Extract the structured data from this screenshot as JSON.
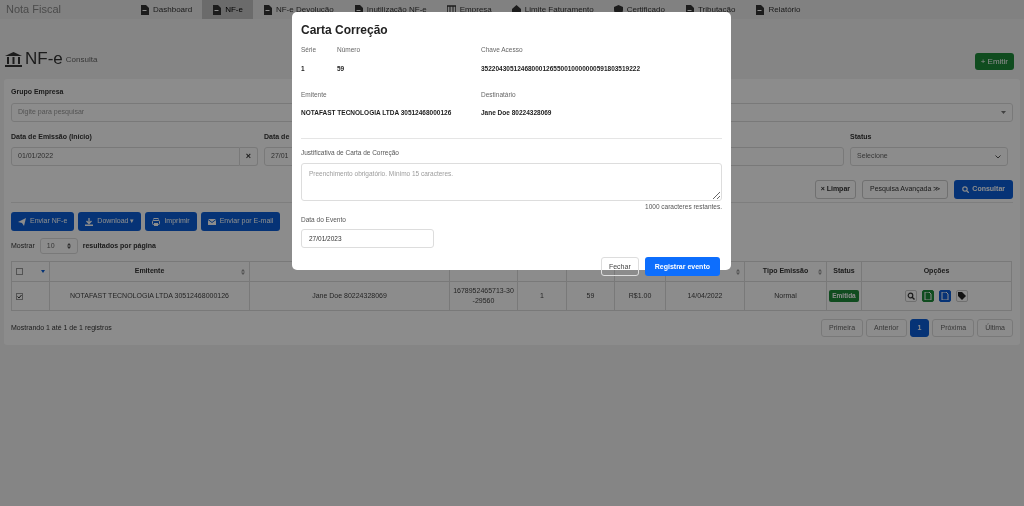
{
  "app_title": "Nota Fiscal",
  "nav": [
    {
      "label": "Dashboard",
      "selected": false
    },
    {
      "label": "NF-e",
      "selected": true
    },
    {
      "label": "NF-e Devolução",
      "selected": false
    },
    {
      "label": "Inutilização NF-e",
      "selected": false
    },
    {
      "label": "Empresa",
      "selected": false
    },
    {
      "label": "Limite Faturamento",
      "selected": false
    },
    {
      "label": "Certificado",
      "selected": false
    },
    {
      "label": "Tributação",
      "selected": false
    },
    {
      "label": "Relatório",
      "selected": false
    }
  ],
  "page": {
    "title": "NF-e",
    "subtitle": "Consulta",
    "emit_button": "+ Emitir"
  },
  "filters": {
    "grupo_label": "Grupo Empresa",
    "grupo_placeholder": "Digite para pesquisar",
    "inicio_label": "Data de Emissão (Início)",
    "inicio_value": "01/01/2022",
    "clear_glyph": "×",
    "fim_label": "Data de",
    "fim_value": "27/01",
    "status_label": "Status",
    "status_value": "Selecione",
    "buttons": [
      "× Limpar",
      "Pesquisa Avançada ≫",
      "Consultar"
    ]
  },
  "actions": [
    "Enviar NF-e",
    "Download ▾",
    "Imprimir",
    "Enviar por E-mail"
  ],
  "page_size": {
    "before": "Mostrar",
    "value": "10",
    "after": "resultados por página"
  },
  "table": {
    "columns": [
      {
        "label": "Emitente",
        "sortable": true
      },
      {},
      {},
      {},
      {},
      {},
      {
        "sortable": true
      },
      {
        "label": "Tipo Emissão",
        "sortable": true
      },
      {
        "label": "Status",
        "sortable": false
      },
      {
        "label": "Opções",
        "sortable": false
      }
    ],
    "rows": [
      {
        "checked": true,
        "cells": [
          "NOTAFAST TECNOLOGIA LTDA 30512468000126",
          "Jane Doe 80224328069",
          "1678952465713-30-29560",
          "1",
          "59",
          "R$1.00",
          "14/04/2022",
          "Normal"
        ],
        "status": "Emitida"
      }
    ]
  },
  "footer": {
    "info": "Mostrando 1 até 1 de 1 registros",
    "pages": [
      {
        "label": "Primeira",
        "selected": false
      },
      {
        "label": "Anterior",
        "selected": false
      },
      {
        "label": "1",
        "selected": true
      },
      {
        "label": "Próxima",
        "selected": false
      },
      {
        "label": "Última",
        "selected": false
      }
    ]
  },
  "modal": {
    "title": "Carta Correção",
    "serie_label": "Série",
    "serie": "1",
    "numero_label": "Número",
    "numero": "59",
    "chave_label": "Chave Acesso",
    "chave": "35220430512468000126550010000000591803519222",
    "emitente_label": "Emitente",
    "emitente": "NOTAFAST TECNOLOGIA LTDA 30512468000126",
    "destinatario_label": "Destinatário",
    "destinatario": "Jane Doe 80224328069",
    "justificativa_label": "Justificativa de Carta de Correção",
    "justificativa_placeholder": "Preenchimento obrigatório. Mínimo 15 caracteres.",
    "remaining": "1000 caracteres restantes.",
    "data_label": "Data do Evento",
    "data_value": "27/01/2023",
    "close_button": "Fechar",
    "submit_button": "Registrar evento"
  }
}
